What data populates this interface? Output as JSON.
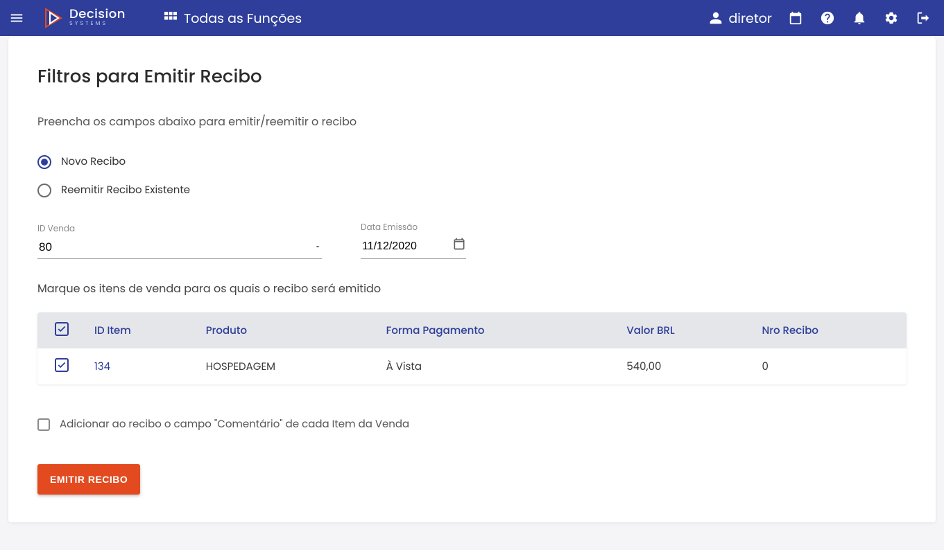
{
  "header": {
    "logo": {
      "title": "Decision",
      "subtitle": "SYSTEMS"
    },
    "apps_label": "Todas as Funções",
    "username": "diretor"
  },
  "card": {
    "title": "Filtros para Emitir Recibo",
    "subtitle": "Preencha os campos abaixo para emitir/reemitir o recibo",
    "radios": {
      "novo": "Novo Recibo",
      "reemitir": "Reemitir Recibo Existente"
    },
    "fields": {
      "id_venda_label": "ID Venda",
      "id_venda_value": "80",
      "data_emissao_label": "Data Emissão",
      "data_emissao_value": "11/12/2020"
    },
    "instruction": "Marque os itens de venda para os quais o recibo será emitido",
    "table": {
      "headers": {
        "id_item": "ID Item",
        "produto": "Produto",
        "forma": "Forma Pagamento",
        "valor": "Valor BRL",
        "nro": "Nro Recibo"
      },
      "rows": [
        {
          "id_item": "134",
          "produto": "HOSPEDAGEM",
          "forma": "À Vista",
          "valor": "540,00",
          "nro": "0"
        }
      ]
    },
    "add_comment_label": "Adicionar ao recibo o campo \"Comentário\" de cada Item da Venda",
    "emit_button": "EMITIR RECIBO"
  }
}
